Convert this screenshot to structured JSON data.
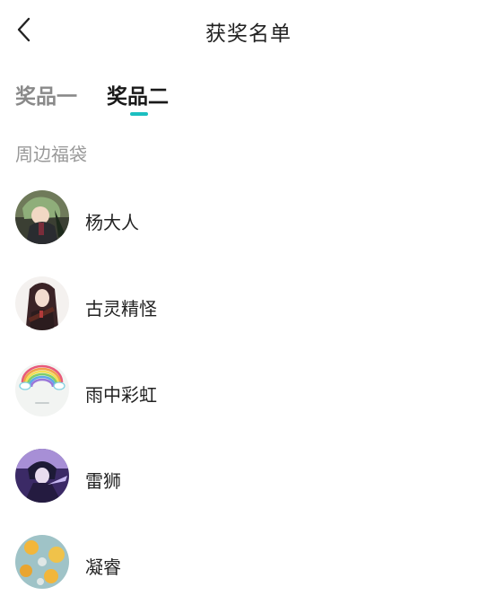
{
  "header": {
    "back_icon": "chevron-left-icon",
    "title": "获奖名单"
  },
  "tabs": [
    {
      "label": "奖品一",
      "active": false
    },
    {
      "label": "奖品二",
      "active": true
    }
  ],
  "accent_color": "#1bbfc0",
  "section": {
    "label": "周边福袋"
  },
  "winners": [
    {
      "name": "杨大人",
      "avatar": "anime-character-avatar"
    },
    {
      "name": "古灵精怪",
      "avatar": "anime-girl-avatar"
    },
    {
      "name": "雨中彩虹",
      "avatar": "rainbow-avatar"
    },
    {
      "name": "雷狮",
      "avatar": "anime-character-purple-avatar"
    },
    {
      "name": "凝睿",
      "avatar": "food-photo-avatar"
    }
  ]
}
